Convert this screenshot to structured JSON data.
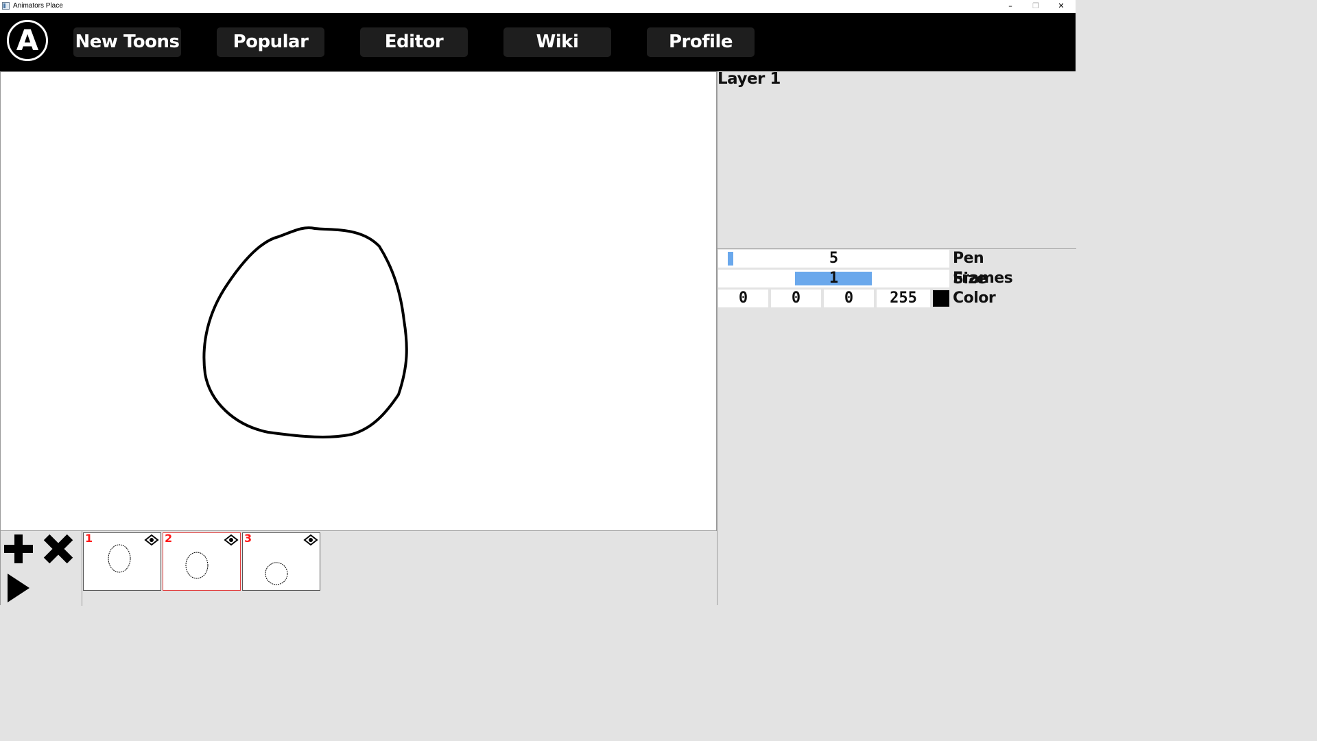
{
  "window": {
    "title": "Animators Place",
    "minimize": "–",
    "restore": "❐",
    "close": "✕"
  },
  "header": {
    "logo_letter": "A",
    "nav": [
      {
        "label": "New Toons"
      },
      {
        "label": "Popular"
      },
      {
        "label": "Editor"
      },
      {
        "label": "Wiki"
      },
      {
        "label": "Profile"
      }
    ]
  },
  "panel": {
    "layer_label": "Layer 1",
    "pen_size": {
      "value": "5",
      "label": "Pen Size",
      "fraction": 0.05
    },
    "frames": {
      "value": "1",
      "label": "Frames",
      "fraction": 0.33
    },
    "color": {
      "r": "0",
      "g": "0",
      "b": "0",
      "a": "255",
      "label": "Color",
      "swatch": "#000000"
    }
  },
  "timeline": {
    "tools": [
      "plus-icon",
      "delete-x-icon",
      "play-icon"
    ],
    "frames": [
      {
        "number": "1",
        "selected": false
      },
      {
        "number": "2",
        "selected": true
      },
      {
        "number": "3",
        "selected": false
      }
    ]
  },
  "colors": {
    "accent_fill": "#6aa8ec",
    "frame_number": "#ff1a1a",
    "header_bg": "#000000",
    "nav_bg": "#1e1e1e"
  }
}
